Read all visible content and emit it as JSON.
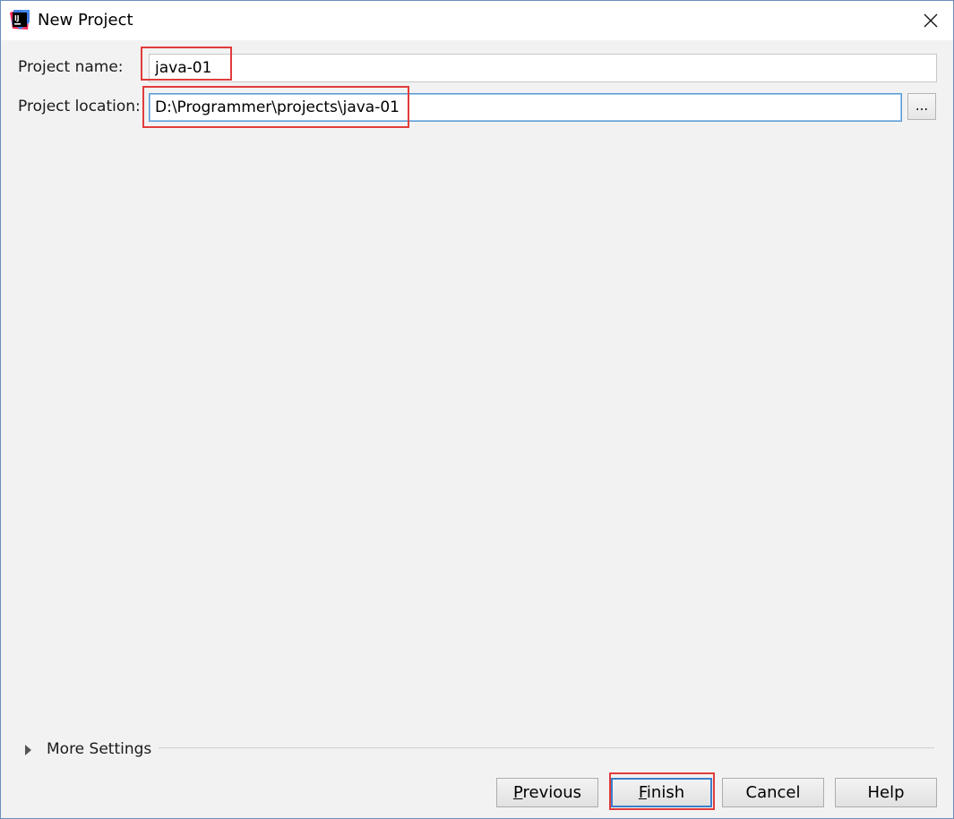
{
  "window": {
    "title": "New Project",
    "app_icon_text": "IJ"
  },
  "form": {
    "project_name_label": "Project name:",
    "project_name_value": "java-01",
    "project_location_label": "Project location:",
    "project_location_value": "D:\\Programmer\\projects\\java-01",
    "browse_label": "..."
  },
  "more_settings": {
    "label": "More Settings",
    "expanded": false
  },
  "buttons": {
    "previous": {
      "mnemonic": "P",
      "rest": "revious"
    },
    "finish": {
      "mnemonic": "F",
      "rest": "inish"
    },
    "cancel": {
      "label": "Cancel"
    },
    "help": {
      "label": "Help"
    }
  },
  "colors": {
    "annotation": "#e23b3b",
    "focus": "#5a9ad6",
    "default_button_border": "#3c7fcb"
  }
}
